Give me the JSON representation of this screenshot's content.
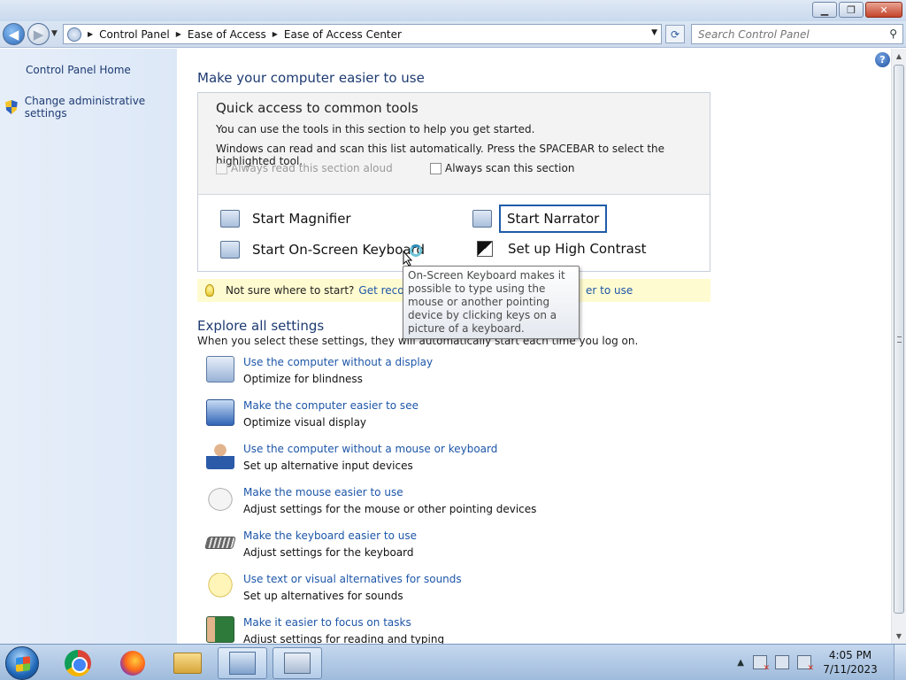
{
  "window": {
    "minimize": "▁",
    "maximize": "❐",
    "close": "✕"
  },
  "address": {
    "crumbs": [
      "Control Panel",
      "Ease of Access",
      "Ease of Access Center"
    ],
    "search_placeholder": "Search Control Panel"
  },
  "sidebar": {
    "home": "Control Panel Home",
    "admin": "Change administrative settings"
  },
  "main": {
    "heading": "Make your computer easier to use",
    "help": "?",
    "quick": {
      "title": "Quick access to common tools",
      "line1": "You can use the tools in this section to help you get started.",
      "line2": "Windows can read and scan this list automatically.  Press the SPACEBAR to select the highlighted tool.",
      "read_aloud": "Always read this section aloud",
      "scan": "Always scan this section",
      "tools": {
        "magnifier": "Start Magnifier",
        "narrator": "Start Narrator",
        "osk": "Start On-Screen Keyboard",
        "contrast": "Set up High Contrast"
      }
    },
    "tip": {
      "text": "Not sure where to start?",
      "link_start": "Get recomme",
      "link_end": "er to use"
    },
    "tooltip": "On-Screen Keyboard makes it possible to type using the mouse or another pointing device by clicking keys on a picture of a keyboard.",
    "explore": {
      "title": "Explore all settings",
      "subtitle": "When you select these settings, they will automatically start each time you log on.",
      "items": [
        {
          "link": "Use the computer without a display",
          "desc": "Optimize for blindness",
          "icon": "display-icon"
        },
        {
          "link": "Make the computer easier to see",
          "desc": "Optimize visual display",
          "icon": "monitor-icon"
        },
        {
          "link": "Use the computer without a mouse or keyboard",
          "desc": "Set up alternative input devices",
          "icon": "person-icon"
        },
        {
          "link": "Make the mouse easier to use",
          "desc": "Adjust settings for the mouse or other pointing devices",
          "icon": "mouse-icon"
        },
        {
          "link": "Make the keyboard easier to use",
          "desc": "Adjust settings for the keyboard",
          "icon": "keyboard-icon"
        },
        {
          "link": "Use text or visual alternatives for sounds",
          "desc": "Set up alternatives for sounds",
          "icon": "speech-bubble-icon"
        },
        {
          "link": "Make it easier to focus on tasks",
          "desc": "Adjust settings for reading and typing",
          "icon": "focus-icon"
        }
      ]
    }
  },
  "taskbar": {
    "time": "4:05 PM",
    "date": "7/11/2023"
  }
}
